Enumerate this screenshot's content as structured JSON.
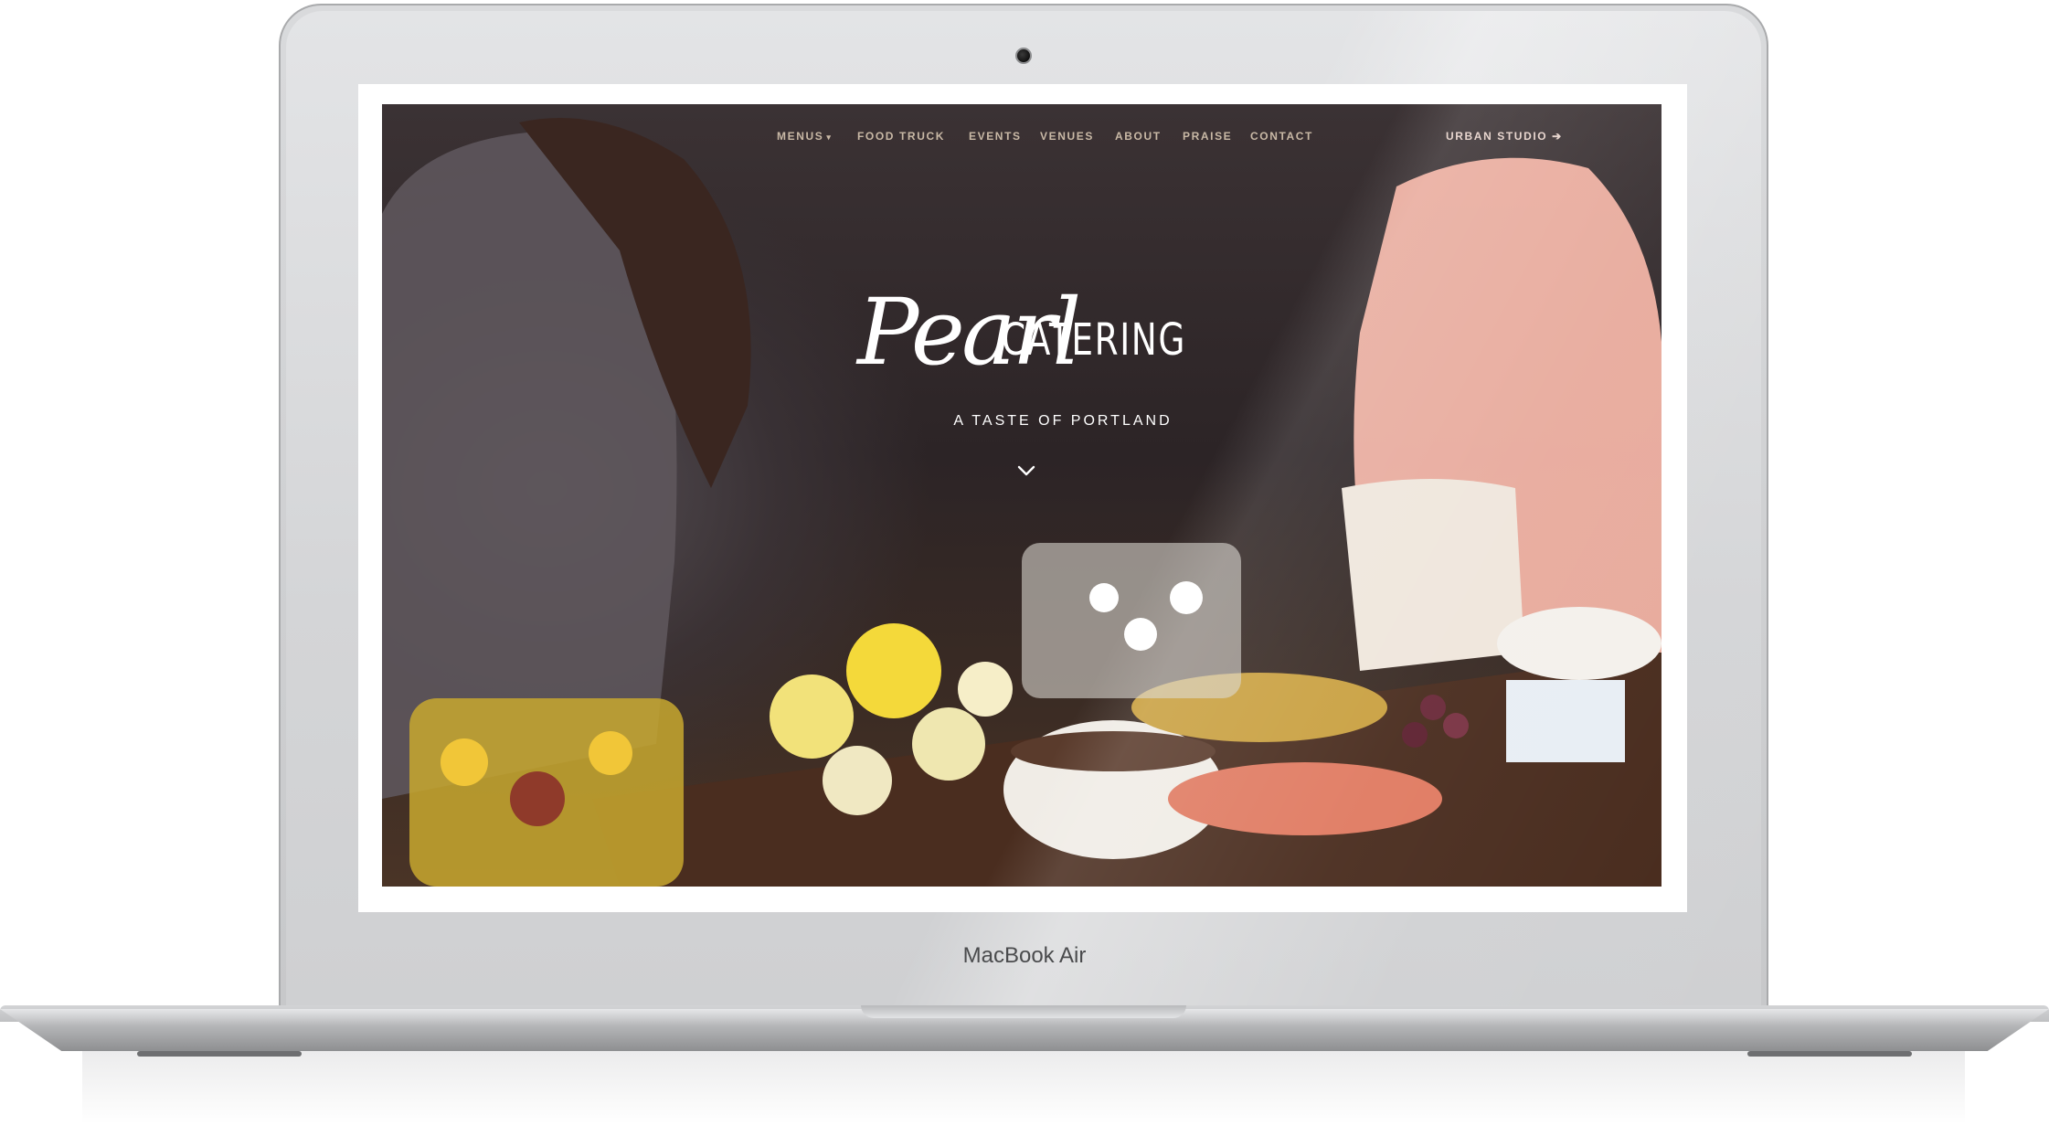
{
  "device": {
    "model_label": "MacBook Air"
  },
  "site": {
    "nav": {
      "menus_label": "MENUS",
      "menus_caret": "▾",
      "food_truck_label": "FOOD TRUCK",
      "events_label": "EVENTS",
      "venues_label": "VENUES",
      "about_label": "ABOUT",
      "praise_label": "PRAISE",
      "contact_label": "CONTACT",
      "urban_studio_label": "URBAN STUDIO",
      "urban_studio_arrow": "➔"
    },
    "hero": {
      "logo_script": "Pearl",
      "logo_word": "CATERING",
      "tagline": "A TASTE OF PORTLAND",
      "scroll_icon": "chevron-down-icon"
    }
  },
  "colors": {
    "nav_text": "#c9b9a6",
    "hero_text": "#ffffff",
    "frame_silver": "#d4d5d7"
  }
}
